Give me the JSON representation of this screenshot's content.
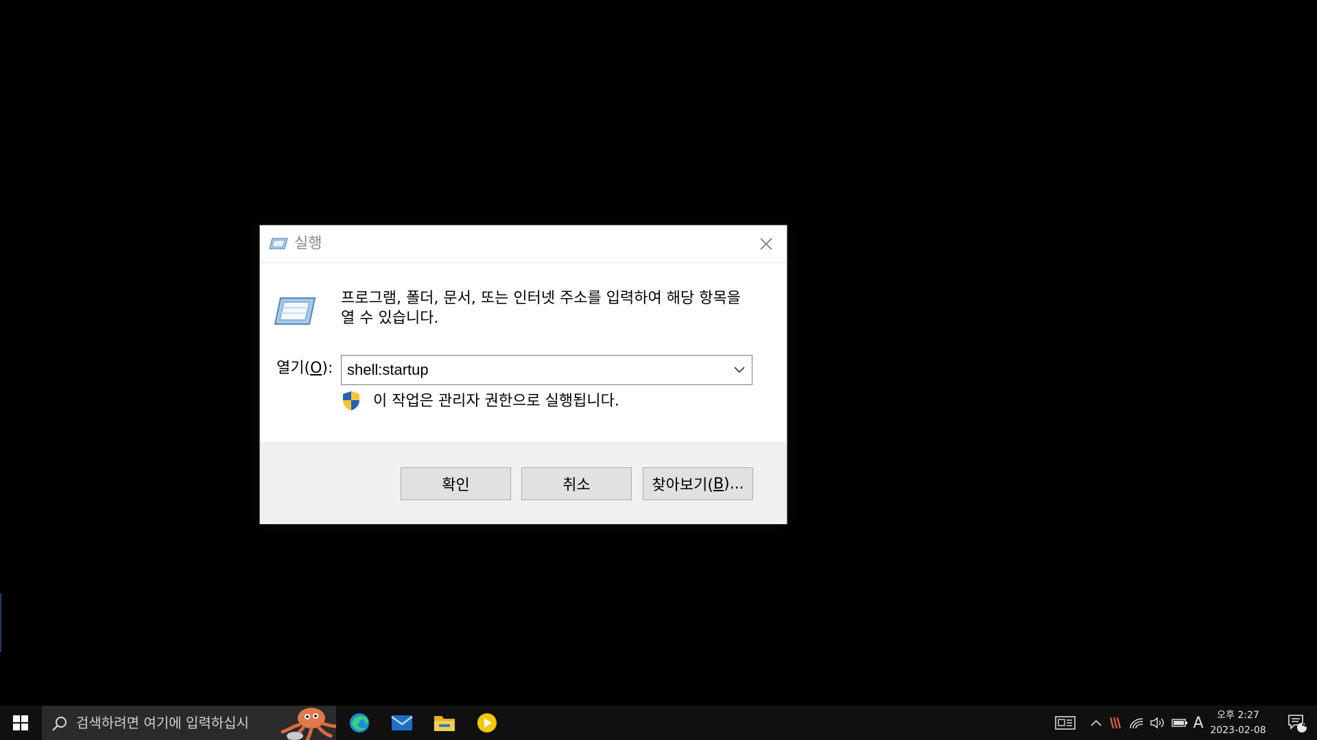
{
  "dialog": {
    "title": "실행",
    "description": "프로그램, 폴더, 문서, 또는 인터넷 주소를 입력하여 해당 항목을 열 수 있습니다.",
    "open_label_prefix": "열기(",
    "open_label_key": "O",
    "open_label_suffix": "):",
    "input_value": "shell:startup",
    "admin_notice": "이 작업은 관리자 권한으로 실행됩니다.",
    "ok_label": "확인",
    "cancel_label": "취소",
    "browse_label_prefix": "찾아보기(",
    "browse_label_key": "B",
    "browse_label_suffix": ")..."
  },
  "taskbar": {
    "search_placeholder": "검색하려면 여기에 입력하십시",
    "apps": [
      "edge-icon",
      "mail-icon",
      "file-explorer-icon",
      "media-player-icon"
    ],
    "tray": {
      "ime_label": "A",
      "time": "오후 2:27",
      "date": "2023-02-08",
      "notification_count": "4"
    }
  },
  "colors": {
    "desktop": "#000000",
    "taskbar": "#101010",
    "search_box": "#2b2b2b",
    "button_bar": "#f0f0f0",
    "button": "#e1e1e1"
  }
}
